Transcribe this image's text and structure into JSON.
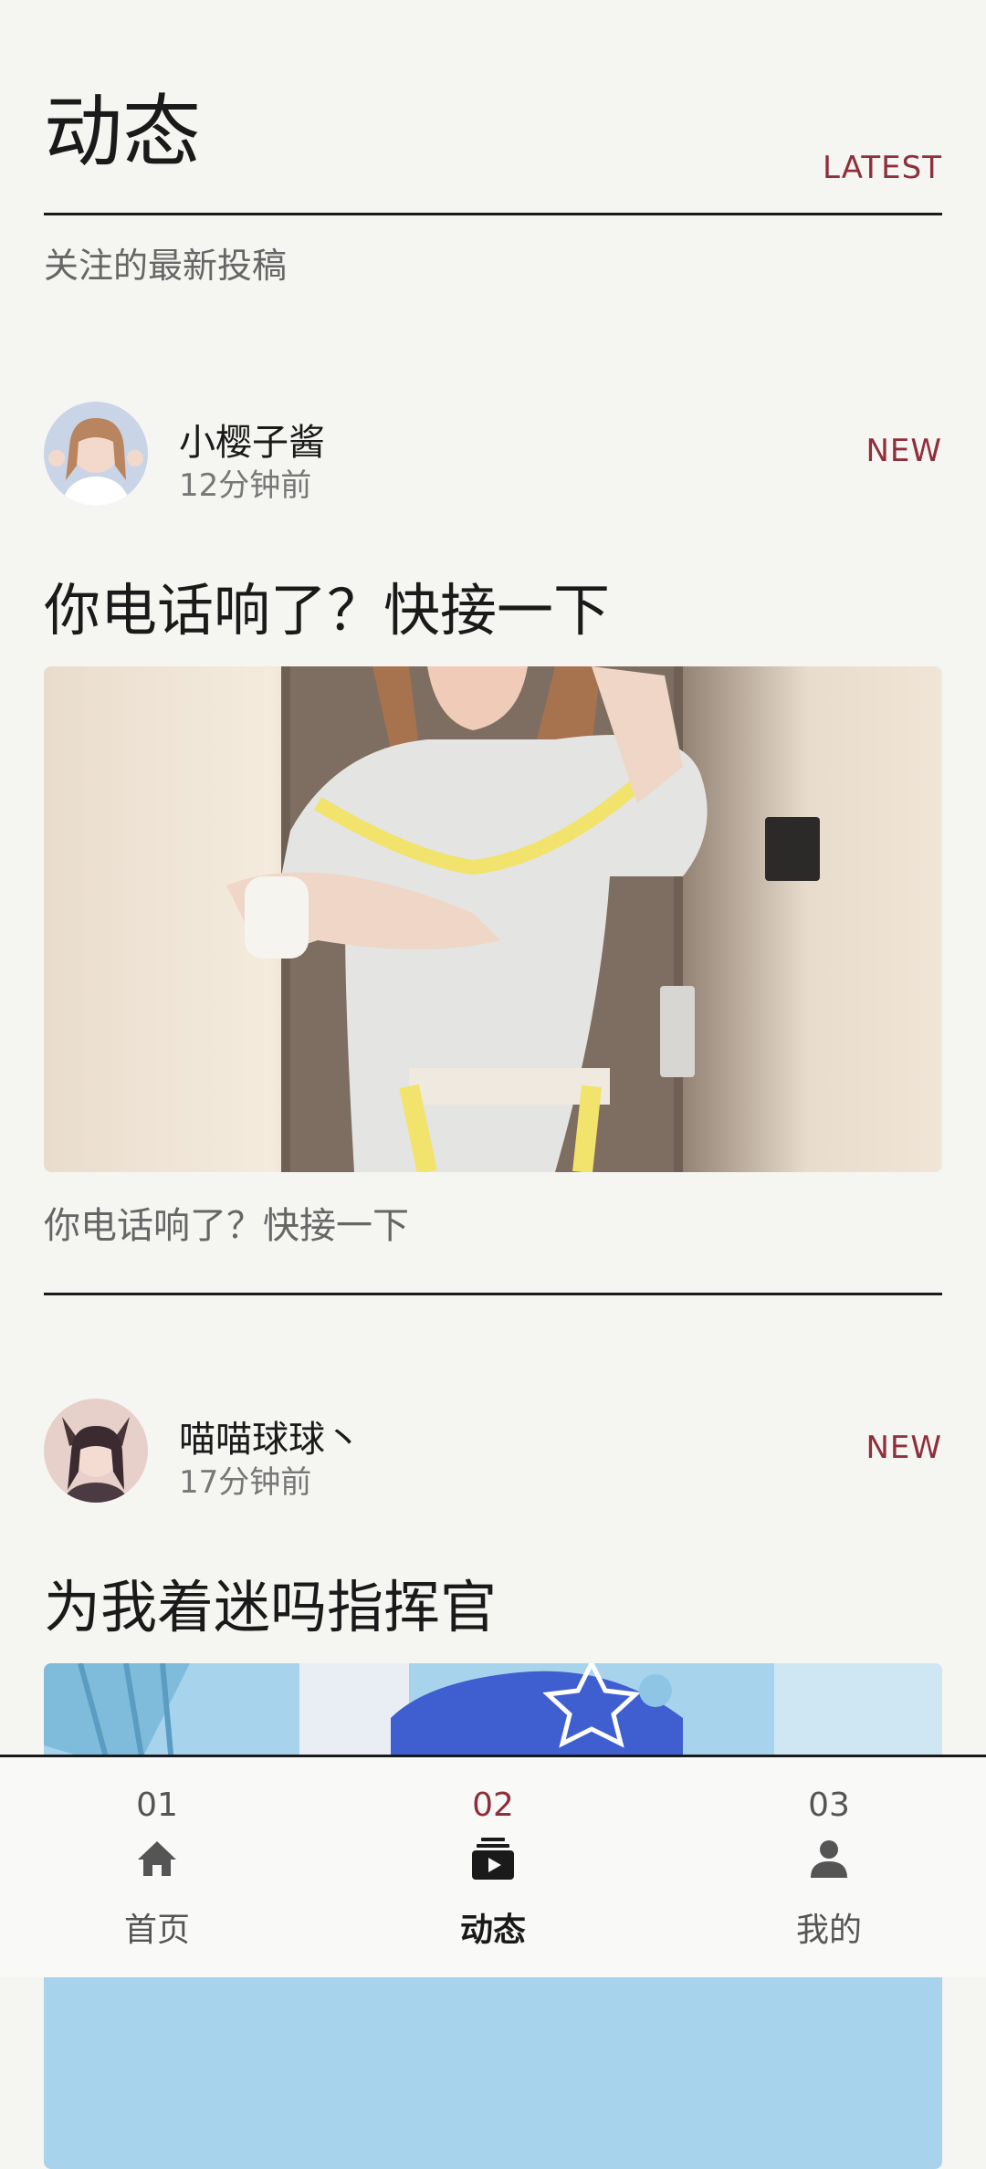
{
  "header": {
    "title": "动态",
    "tag": "LATEST",
    "subtitle": "关注的最新投稿"
  },
  "posts": [
    {
      "author": "小樱子酱",
      "time": "12分钟前",
      "badge": "NEW",
      "title": "你电话响了？快接一下",
      "caption": "你电话响了？快接一下"
    },
    {
      "author": "喵喵球球丶",
      "time": "17分钟前",
      "badge": "NEW",
      "title": "为我着迷吗指挥官"
    }
  ],
  "nav": {
    "items": [
      {
        "num": "01",
        "label": "首页",
        "icon": "home-icon"
      },
      {
        "num": "02",
        "label": "动态",
        "icon": "video-feed-icon",
        "active": true
      },
      {
        "num": "03",
        "label": "我的",
        "icon": "profile-icon"
      }
    ]
  },
  "colors": {
    "accent": "#8e2f3b",
    "background": "#f5f5f2",
    "text": "#1a1a1a"
  }
}
